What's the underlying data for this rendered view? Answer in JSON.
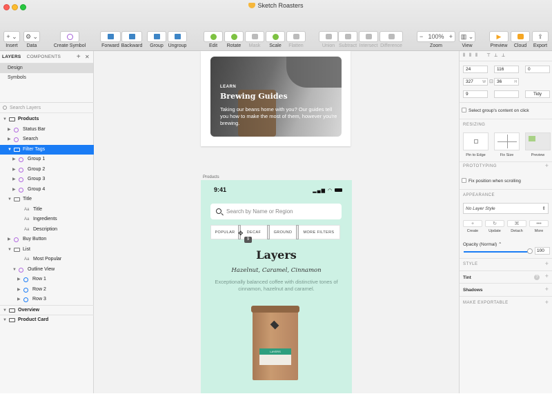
{
  "window": {
    "title": "Sketch Roasters"
  },
  "toolbar": {
    "insert": "Insert",
    "data": "Data",
    "create_symbol": "Create Symbol",
    "forward": "Forward",
    "backward": "Backward",
    "group": "Group",
    "ungroup": "Ungroup",
    "edit": "Edit",
    "rotate": "Rotate",
    "mask": "Mask",
    "scale": "Scale",
    "flatten": "Flatten",
    "union": "Union",
    "subtract": "Subtract",
    "intersect": "Intersect",
    "difference": "Difference",
    "zoom_label": "Zoom",
    "zoom_value": "100%",
    "zoom_minus": "−",
    "zoom_plus": "+",
    "view": "View",
    "preview": "Preview",
    "cloud": "Cloud",
    "export": "Export"
  },
  "sidebar": {
    "tab_layers": "LAYERS",
    "tab_components": "COMPONENTS",
    "pages": [
      "Design",
      "Symbols"
    ],
    "search_placeholder": "Search Layers",
    "layers": [
      {
        "name": "Products",
        "kind": "artboard",
        "indent": 0,
        "expanded": true
      },
      {
        "name": "Status Bar",
        "kind": "symbol",
        "indent": 1,
        "expanded": false
      },
      {
        "name": "Search",
        "kind": "symbol",
        "indent": 1,
        "expanded": false
      },
      {
        "name": "Filter Tags",
        "kind": "folder",
        "indent": 1,
        "expanded": true,
        "selected": true
      },
      {
        "name": "Group 1",
        "kind": "symbol",
        "indent": 2,
        "expanded": false
      },
      {
        "name": "Group 2",
        "kind": "symbol",
        "indent": 2,
        "expanded": false
      },
      {
        "name": "Group 3",
        "kind": "symbol",
        "indent": 2,
        "expanded": false
      },
      {
        "name": "Group 4",
        "kind": "symbol",
        "indent": 2,
        "expanded": false
      },
      {
        "name": "Title",
        "kind": "folder",
        "indent": 1,
        "expanded": true
      },
      {
        "name": "Title",
        "kind": "text",
        "indent": 2
      },
      {
        "name": "Ingredients",
        "kind": "text",
        "indent": 2
      },
      {
        "name": "Description",
        "kind": "text",
        "indent": 2
      },
      {
        "name": "Buy Button",
        "kind": "symbol",
        "indent": 1,
        "expanded": false
      },
      {
        "name": "List",
        "kind": "folder",
        "indent": 1,
        "expanded": true
      },
      {
        "name": "Most Popular",
        "kind": "text",
        "indent": 2
      },
      {
        "name": "Outline View",
        "kind": "symbol",
        "indent": 2,
        "expanded": true
      },
      {
        "name": "Row 1",
        "kind": "symbol-blue",
        "indent": 3,
        "expanded": false
      },
      {
        "name": "Row 2",
        "kind": "symbol-blue",
        "indent": 3,
        "expanded": false
      },
      {
        "name": "Row 3",
        "kind": "symbol-blue",
        "indent": 3,
        "expanded": false
      },
      {
        "name": "Overview",
        "kind": "artboard",
        "indent": 0,
        "expanded": true,
        "group_top": true
      },
      {
        "name": "Product Card",
        "kind": "artboard",
        "indent": 0,
        "expanded": true,
        "group_top": true
      }
    ]
  },
  "canvas": {
    "card": {
      "kicker": "LEARN",
      "title": "Brewing Guides",
      "body": "Taking our beans home with you? Our guides tell you how to make the most of them, however you're brewing."
    },
    "artboard_label": "Products",
    "phone": {
      "time": "9:41",
      "search_placeholder": "Search by Name or Region",
      "filters": [
        "POPULAR",
        "DECAF",
        "GROUND",
        "MORE FILTERS"
      ],
      "spacing_badge": "9",
      "title": "Layers",
      "subtitle": "Hazelnut, Caramel, Cinnamon",
      "description": "Exceptionally balanced coffee with distinctive tones of cinnamon, hazelnut and caramel.",
      "bag_label": "LAYERS"
    }
  },
  "inspector": {
    "x": "24",
    "y": "116",
    "rotation": "0",
    "width": "327",
    "w_sub": "W",
    "height": "36",
    "h_sub": "H",
    "spacing": "9",
    "tidy": "Tidy",
    "select_on_click": "Select group's content on click",
    "resizing": "RESIZING",
    "pin_to_edge": "Pin to Edge",
    "fix_size": "Fix Size",
    "preview": "Preview",
    "prototyping": "PROTOTYPING",
    "fix_position": "Fix position when scrolling",
    "appearance": "APPEARANCE",
    "layer_style": "No Layer Style",
    "style_buttons": [
      "Create",
      "Update",
      "Detach",
      "More"
    ],
    "opacity_label": "Opacity (Normal)",
    "opacity": "100",
    "style": "STYLE",
    "tint": "Tint",
    "shadows": "Shadows",
    "make_exportable": "MAKE EXPORTABLE"
  },
  "colors": {
    "selection": "#1a7cf5",
    "symbol": "#b26be0",
    "phone_bg": "#cdf1e4"
  }
}
